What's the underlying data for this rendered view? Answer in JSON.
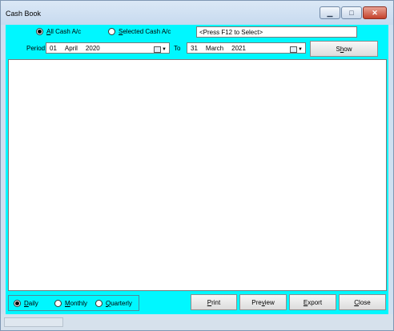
{
  "window": {
    "title": "Cash Book"
  },
  "controls": {
    "all_accounts": {
      "prefix": "",
      "access_key": "A",
      "rest": "ll Cash A/c",
      "selected": true
    },
    "selected_accounts": {
      "prefix": "",
      "access_key": "S",
      "rest": "elected Cash A/c",
      "selected": false
    },
    "account_field": "<Press F12 to Select>",
    "period_label": "Period:",
    "from_date": {
      "day": "01",
      "month": "April",
      "year": "2020"
    },
    "to_label": "To",
    "to_date": {
      "day": "31",
      "month": "March",
      "year": "2021"
    },
    "show": {
      "prefix": "S",
      "access_key": "h",
      "rest": "ow"
    }
  },
  "frequency": {
    "daily": {
      "prefix": "",
      "access_key": "D",
      "rest": "aily",
      "selected": true
    },
    "monthly": {
      "prefix": "",
      "access_key": "M",
      "rest": "onthly",
      "selected": false
    },
    "quarterly": {
      "prefix": "",
      "access_key": "Q",
      "rest": "uarterly",
      "selected": false
    }
  },
  "actions": {
    "print": {
      "prefix": "",
      "access_key": "P",
      "rest": "rint"
    },
    "preview": {
      "prefix": "Pre",
      "access_key": "v",
      "rest": "iew"
    },
    "export": {
      "prefix": "",
      "access_key": "E",
      "rest": "xport"
    },
    "close": {
      "prefix": "",
      "access_key": "C",
      "rest": "lose"
    }
  },
  "colors": {
    "client_background": "#00f7ff",
    "titlebar": "#cfe0f1",
    "close_button": "#c4412b"
  },
  "icons": [
    "minimize-icon",
    "maximize-icon",
    "close-icon",
    "calendar-icon",
    "dropdown-arrow-icon"
  ]
}
